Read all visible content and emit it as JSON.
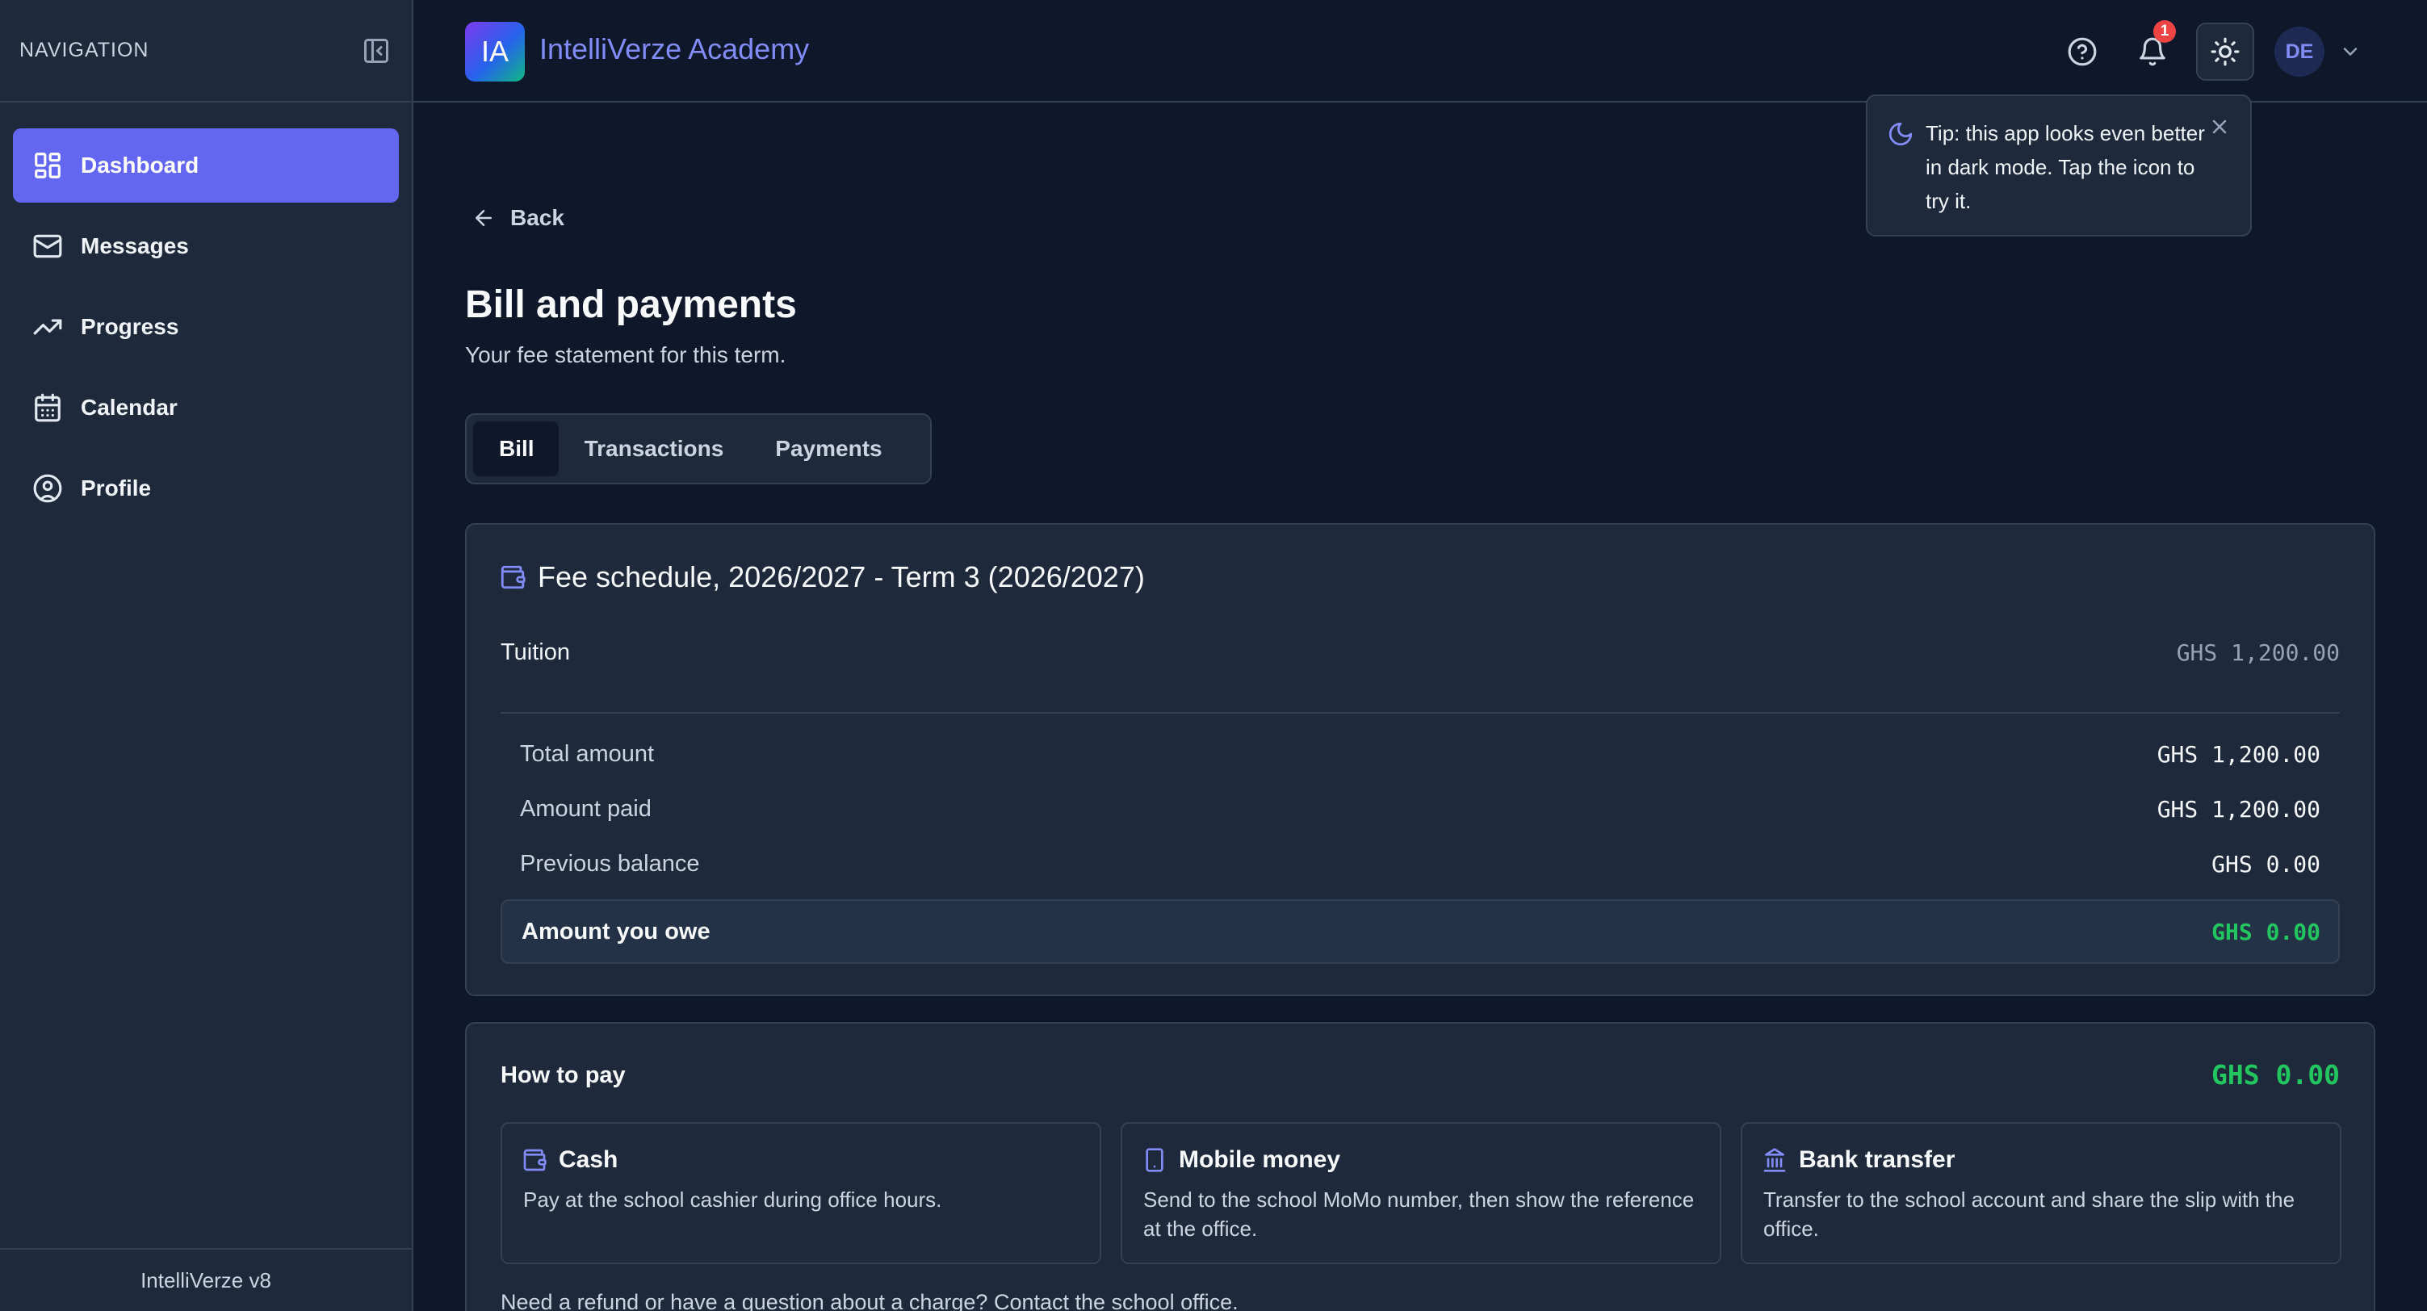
{
  "sidebar": {
    "heading": "NAVIGATION",
    "items": [
      {
        "label": "Dashboard",
        "icon": "dashboard-icon",
        "active": true
      },
      {
        "label": "Messages",
        "icon": "mail-icon"
      },
      {
        "label": "Progress",
        "icon": "trending-up-icon"
      },
      {
        "label": "Calendar",
        "icon": "calendar-icon"
      },
      {
        "label": "Profile",
        "icon": "user-circle-icon"
      }
    ],
    "footer": "IntelliVerze v8"
  },
  "header": {
    "logo_text": "IA",
    "brand": "IntelliVerze Academy",
    "notification_count": "1",
    "avatar_initials": "DE"
  },
  "tooltip": {
    "text": "Tip: this app looks even better in dark mode. Tap the icon to try it."
  },
  "page": {
    "back_label": "Back",
    "title": "Bill and payments",
    "subtitle": "Your fee statement for this term.",
    "tabs": [
      "Bill",
      "Transactions",
      "Payments"
    ],
    "active_tab": "Bill"
  },
  "fee_schedule": {
    "title": "Fee schedule, 2026/2027 - Term 3 (2026/2027)",
    "items": [
      {
        "label": "Tuition",
        "amount": "GHS 1,200.00"
      }
    ],
    "summary": [
      {
        "label": "Total amount",
        "amount": "GHS 1,200.00"
      },
      {
        "label": "Amount paid",
        "amount": "GHS 1,200.00"
      },
      {
        "label": "Previous balance",
        "amount": "GHS 0.00"
      }
    ],
    "owe": {
      "label": "Amount you owe",
      "amount": "GHS 0.00"
    }
  },
  "how_to_pay": {
    "title": "How to pay",
    "amount": "GHS 0.00",
    "methods": [
      {
        "title": "Cash",
        "description": "Pay at the school cashier during office hours.",
        "icon": "wallet-icon"
      },
      {
        "title": "Mobile money",
        "description": "Send to the school MoMo number, then show the reference at the office.",
        "icon": "phone-icon"
      },
      {
        "title": "Bank transfer",
        "description": "Transfer to the school account and share the slip with the office.",
        "icon": "bank-icon"
      }
    ],
    "note": "Need a refund or have a question about a charge? Contact the school office."
  },
  "colors": {
    "background": "#0f172a",
    "surface": "#1e293b",
    "border": "#334155",
    "accent": "#6366f1",
    "success": "#22c55e",
    "danger": "#ef4444"
  }
}
